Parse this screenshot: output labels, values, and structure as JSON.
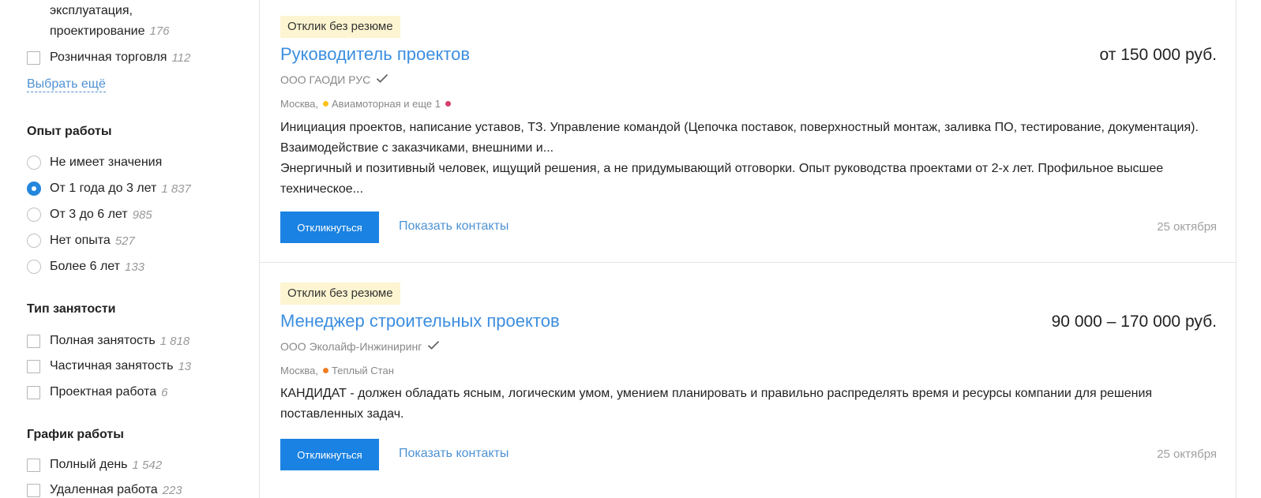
{
  "sidebar": {
    "industry": {
      "partial_line": "эксплуатация,",
      "partial_last_line": "проектирование",
      "partial_count": "176",
      "retail": {
        "label": "Розничная торговля",
        "count": "112"
      },
      "more_label": "Выбрать ещё"
    },
    "experience": {
      "title": "Опыт работы",
      "options": [
        {
          "label": "Не имеет значения",
          "count": "",
          "checked": false
        },
        {
          "label": "От 1 года до 3 лет",
          "count": "1 837",
          "checked": true
        },
        {
          "label": "От 3 до 6 лет",
          "count": "985",
          "checked": false
        },
        {
          "label": "Нет опыта",
          "count": "527",
          "checked": false
        },
        {
          "label": "Более 6 лет",
          "count": "133",
          "checked": false
        }
      ]
    },
    "employment": {
      "title": "Тип занятости",
      "options": [
        {
          "label": "Полная занятость",
          "count": "1 818"
        },
        {
          "label": "Частичная занятость",
          "count": "13"
        },
        {
          "label": "Проектная работа",
          "count": "6"
        }
      ]
    },
    "schedule": {
      "title": "График работы",
      "options": [
        {
          "label": "Полный день",
          "count": "1 542"
        },
        {
          "label": "Удаленная работа",
          "count": "223"
        }
      ]
    }
  },
  "vacancies": [
    {
      "badge": "Отклик без резюме",
      "title": "Руководитель проектов",
      "salary": "от 150 000 руб.",
      "company": "ООО ГАОДИ РУС",
      "city": "Москва,",
      "metro": "Авиамоторная и еще 1",
      "metro_color": "#ffc21a",
      "metro_extra_color": "#d4406a",
      "description_line1": "Инициация проектов, написание уставов, ТЗ. Управление командой (Цепочка поставок, поверхностный монтаж, заливка ПО, тестирование, документация). Взаимодействие с заказчиками, внешними и...",
      "description_line2": "Энергичный и позитивный человек, ищущий решения, а не придумывающий отговорки. Опыт руководства проектами от 2-х лет. Профильное высшее техническое...",
      "respond_label": "Откликнуться",
      "contacts_label": "Показать контакты",
      "date": "25 октября"
    },
    {
      "badge": "Отклик без резюме",
      "title": "Менеджер строительных проектов",
      "salary": "90 000 – 170 000 руб.",
      "company": "ООО Эколайф-Инжиниринг",
      "city": "Москва,",
      "metro": "Теплый Стан",
      "metro_color": "#f07e24",
      "description_line1": "КАНДИДАТ - должен обладать ясным, логическим умом, умением планировать и правильно распределять время и ресурсы компании для решения поставленных задач.",
      "respond_label": "Откликнуться",
      "contacts_label": "Показать контакты",
      "date": "25 октября"
    }
  ]
}
